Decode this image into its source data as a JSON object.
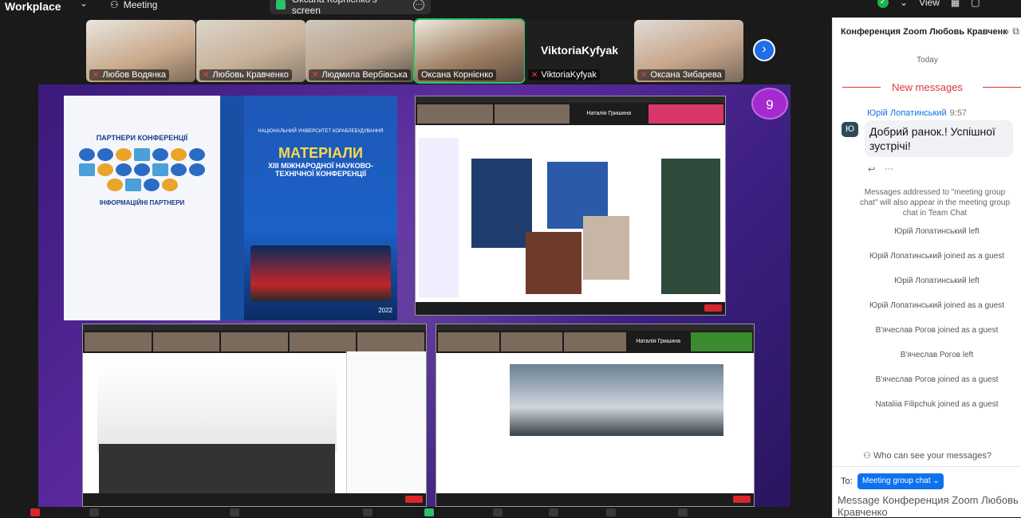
{
  "top": {
    "brand": "Workplace",
    "meeting_label": "Meeting",
    "screen_share_label": "Оксана Корнієнко's screen",
    "view_label": "View"
  },
  "strip": {
    "participants": [
      {
        "name": "Любов Водянка"
      },
      {
        "name": "Любовь Кравченко"
      },
      {
        "name": "Людмила Вербівська"
      },
      {
        "name": "Оксана Корнієнко"
      },
      {
        "name": "ViktoriaKyfyak",
        "display": "ViktoriaKyfyak"
      },
      {
        "name": "Оксана Зибарева"
      }
    ]
  },
  "share": {
    "badge": "9",
    "book": {
      "partners_title": "ПАРТНЕРИ КОНФЕРЕНЦІЇ",
      "info_title": "ІНФОРМАЦІЙНІ ПАРТНЕРИ",
      "uni": "НАЦІОНАЛЬНИЙ УНІВЕРСИТЕТ КОРАБЛЕБУДУВАННЯ",
      "title": "МАТЕРІАЛИ",
      "subtitle": "XIII МІЖНАРОДНОЇ НАУКОВО-ТЕХНІЧНОЇ КОНФЕРЕНЦІЇ",
      "year": "2022"
    },
    "slideB_name": "Наталія Гришина",
    "slideC_name": "Наталія Гришина",
    "slideA_name": "Наталія Гришина"
  },
  "chat": {
    "header": "Конференция Zoom Любовь Кравченко",
    "today": "Today",
    "new_messages": "New messages",
    "sender": "Юрій Лопатинський",
    "time": "9:57",
    "avatar_initial": "Ю",
    "message": "Добрий ранок.! Успішної зустрічі!",
    "system_note": "Messages addressed to \"meeting group chat\" will also appear in the meeting group chat in Team Chat",
    "events": [
      "Юрій Лопатинський left",
      "Юрій Лопатинський joined as a guest",
      "Юрій Лопатинський left",
      "Юрій Лопатинський joined as a guest",
      "В'ячеслав Рогов joined as a guest",
      "В'ячеслав Рогов left",
      "В'ячеслав Рогов joined as a guest",
      "Nataliia Filipchuk joined as a guest"
    ],
    "who_can_see": "Who can see your messages?",
    "to_label": "To:",
    "to_value": "Meeting group chat",
    "input_placeholder": "Message Конференция Zoom Любовь Кравченко"
  },
  "colors": {
    "accent_blue": "#0e72ed",
    "alert_red": "#e0363a",
    "share_bg": "#4a2290",
    "badge_purple": "#a42ad0"
  }
}
